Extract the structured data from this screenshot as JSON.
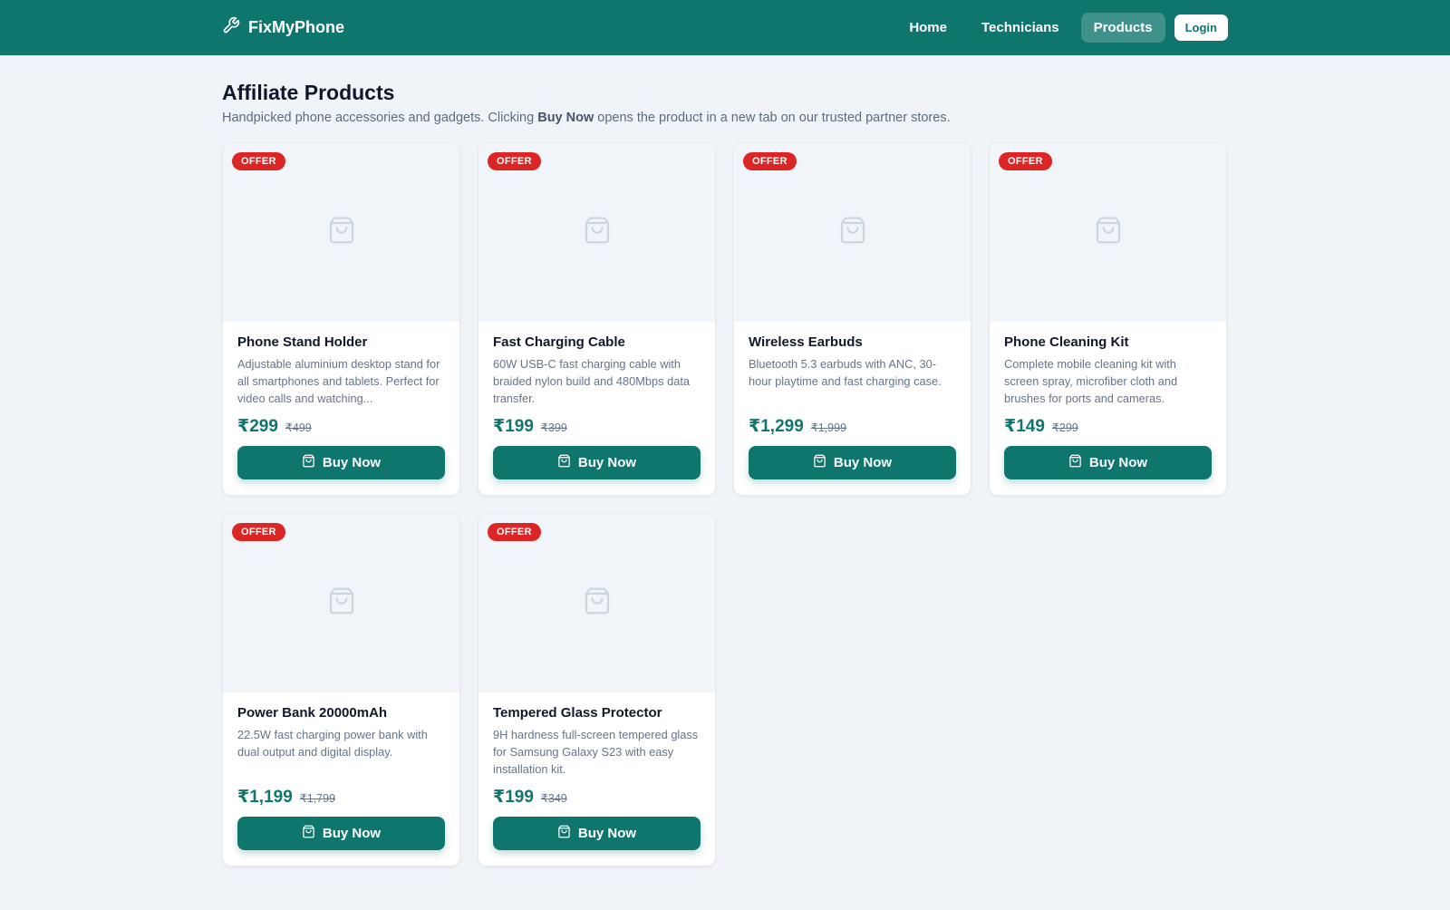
{
  "nav": {
    "brand": "FixMyPhone",
    "links": [
      "Home",
      "Technicians",
      "Products"
    ],
    "active": "Products",
    "login": "Login"
  },
  "page": {
    "title": "Affiliate Products",
    "subtitle_pre": "Handpicked phone accessories and gadgets. Clicking ",
    "subtitle_bold": "Buy Now",
    "subtitle_post": " opens the product in a new tab on our trusted partner stores."
  },
  "products": [
    {
      "badge": "OFFER",
      "name": "Phone Stand Holder",
      "desc": "Adjustable aluminium desktop stand for all smartphones and tablets. Perfect for video calls and watching...",
      "price": "₹299",
      "old_price": "₹499",
      "button": "Buy Now"
    },
    {
      "badge": "OFFER",
      "name": "Fast Charging Cable",
      "desc": "60W USB-C fast charging cable with braided nylon build and 480Mbps data transfer.",
      "price": "₹199",
      "old_price": "₹399",
      "button": "Buy Now"
    },
    {
      "badge": "OFFER",
      "name": "Wireless Earbuds",
      "desc": "Bluetooth 5.3 earbuds with ANC, 30-hour playtime and fast charging case.",
      "price": "₹1,299",
      "old_price": "₹1,999",
      "button": "Buy Now"
    },
    {
      "badge": "OFFER",
      "name": "Phone Cleaning Kit",
      "desc": "Complete mobile cleaning kit with screen spray, microfiber cloth and brushes for ports and cameras.",
      "price": "₹149",
      "old_price": "₹299",
      "button": "Buy Now"
    },
    {
      "badge": "OFFER",
      "name": "Power Bank 20000mAh",
      "desc": "22.5W fast charging power bank with dual output and digital display.",
      "price": "₹1,199",
      "old_price": "₹1,799",
      "button": "Buy Now"
    },
    {
      "badge": "OFFER",
      "name": "Tempered Glass Protector",
      "desc": "9H hardness full-screen tempered glass for Samsung Galaxy S23 with easy installation kit.",
      "price": "₹199",
      "old_price": "₹349",
      "button": "Buy Now"
    }
  ],
  "colors": {
    "primary": "#0f766e",
    "badge": "#dc2626",
    "background": "#f0f4f8"
  },
  "icons": {
    "brand": "wrench-icon",
    "product_placeholder": "shopping-bag-icon",
    "button": "shopping-bag-icon"
  }
}
